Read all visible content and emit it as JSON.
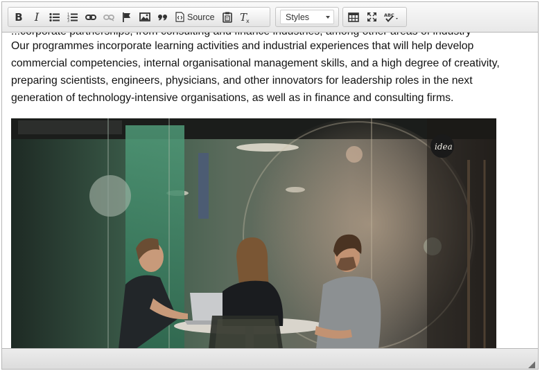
{
  "toolbar": {
    "bold_label": "B",
    "italic_label": "I",
    "source_label": "Source",
    "styles_label": "Styles",
    "icons": {
      "bulleted_list": "bulleted-list-icon",
      "numbered_list": "numbered-list-icon",
      "link": "link-icon",
      "unlink": "unlink-icon",
      "anchor": "flag-icon",
      "image": "image-icon",
      "blockquote": "quote-icon",
      "source": "source-icon",
      "paste": "paste-text-icon",
      "remove_format": "remove-format-icon",
      "table": "table-icon",
      "maximize": "maximize-icon",
      "spellcheck": "spellcheck-icon"
    }
  },
  "content": {
    "partial_line": "...corporate partnerships, from consulting and finance industries, among other areas of industry",
    "paragraph": "Our programmes incorporate learning activities and industrial experiences that will help develop commercial competencies, internal organisational management skills, and a high degree of creativity, preparing scientists, engineers, physicians, and other innovators for leadership roles in the next generation of technology-intensive organisations, as well as in finance and consulting firms.",
    "photo_sign": "idea"
  },
  "colors": {
    "toolbar_bg": "#e8e8e8",
    "border": "#b6b6b6",
    "text": "#111111"
  }
}
